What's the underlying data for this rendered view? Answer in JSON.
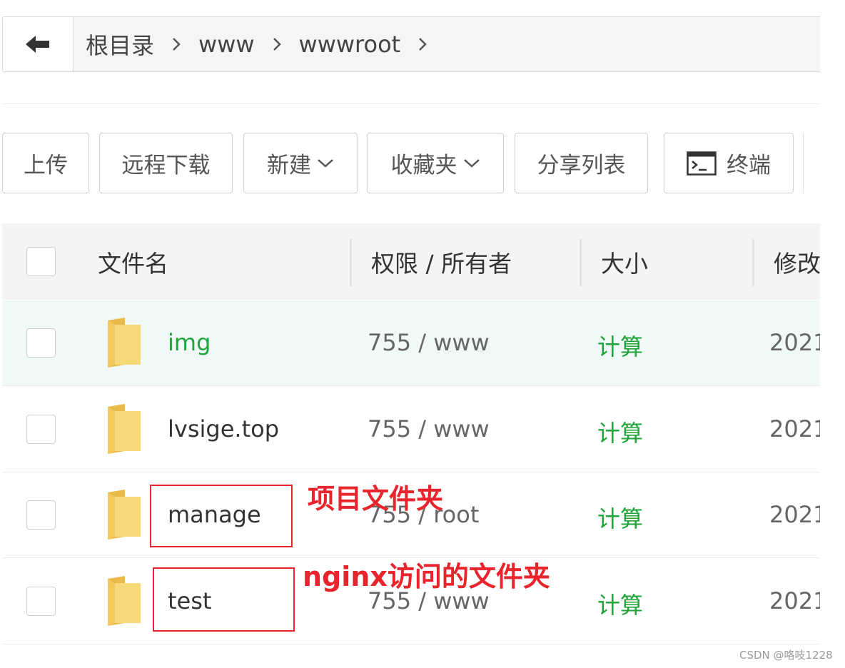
{
  "breadcrumb": {
    "items": [
      "根目录",
      "www",
      "wwwroot"
    ]
  },
  "toolbar": {
    "upload": "上传",
    "remote_download": "远程下载",
    "new": "新建",
    "favorites": "收藏夹",
    "share_list": "分享列表",
    "terminal": "终端"
  },
  "table": {
    "headers": {
      "filename": "文件名",
      "permission_owner": "权限 / 所有者",
      "size": "大小",
      "modified": "修改"
    },
    "rows": [
      {
        "name": "img",
        "perm": "755 / www",
        "size": "计算",
        "date": "2021"
      },
      {
        "name": "lvsige.top",
        "perm": "755 / www",
        "size": "计算",
        "date": "2021"
      },
      {
        "name": "manage",
        "perm": "755 / root",
        "size": "计算",
        "date": "2021"
      },
      {
        "name": "test",
        "perm": "755 / www",
        "size": "计算",
        "date": "2021"
      }
    ]
  },
  "annotations": {
    "project_folder": "项目文件夹",
    "nginx_folder": "nginx访问的文件夹"
  },
  "watermark": "CSDN @咯吱1228",
  "colors": {
    "accent_green": "#20a53a",
    "annotation_red": "#e8242c",
    "folder_yellow": "#f6d36b"
  }
}
